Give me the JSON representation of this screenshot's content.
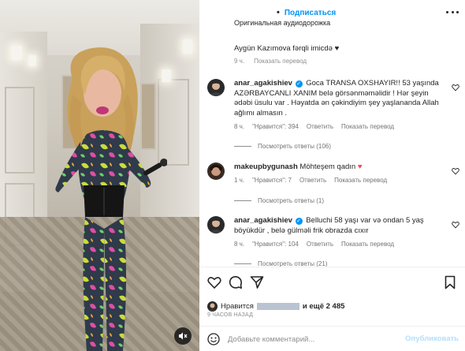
{
  "header": {
    "follow_label": "Подписаться",
    "audio_label": "Оригинальная аудиодорожка"
  },
  "caption": {
    "text": "Aygün Kazımova fərqli imicdə",
    "time": "9 ч.",
    "translate_label": "Показать перевод"
  },
  "comments": [
    {
      "username": "anar_agakishiev",
      "verified": true,
      "text": "Goca TRANSA OXSHAYIR!! 53 yaşında AZƏRBAYCANLI XANIM belə görsənməməlidir ! Hər şeyin ədəbi üsulu var . Həyatda ən çəkindiyim şey yaşlananda Allah ağlımı almasın .",
      "time": "8 ч.",
      "likes_label": "\"Нравится\": 394",
      "reply_label": "Ответить",
      "translate_label": "Показать перевод",
      "replies_label": "Посмотреть ответы (106)"
    },
    {
      "username": "makeupbygunash",
      "verified": false,
      "text": "Möhteşem qadın",
      "time": "1 ч.",
      "likes_label": "\"Нравится\": 7",
      "reply_label": "Ответить",
      "translate_label": "Показать перевод",
      "replies_label": "Посмотреть ответы (1)"
    },
    {
      "username": "anar_agakishiev",
      "verified": true,
      "text": "Belluchi 58 yaşı var və ondan 5 yaş böyükdür , belə gülməli frik obrazda cıxır",
      "time": "8 ч.",
      "likes_label": "\"Нравится\": 104",
      "reply_label": "Ответить",
      "translate_label": "Показать перевод",
      "replies_label": "Посмотреть ответы (21)"
    }
  ],
  "likes": {
    "prefix": "Нравится",
    "suffix": "и ещё 2 485"
  },
  "time_ago": "9 ЧАСОВ НАЗАД",
  "add_comment": {
    "placeholder": "Добавьте комментарий...",
    "publish_label": "Опубликовать"
  },
  "colors": {
    "accent": "#0095f6",
    "heart_red": "#ed4956",
    "muted_text": "#8e8e8e"
  }
}
